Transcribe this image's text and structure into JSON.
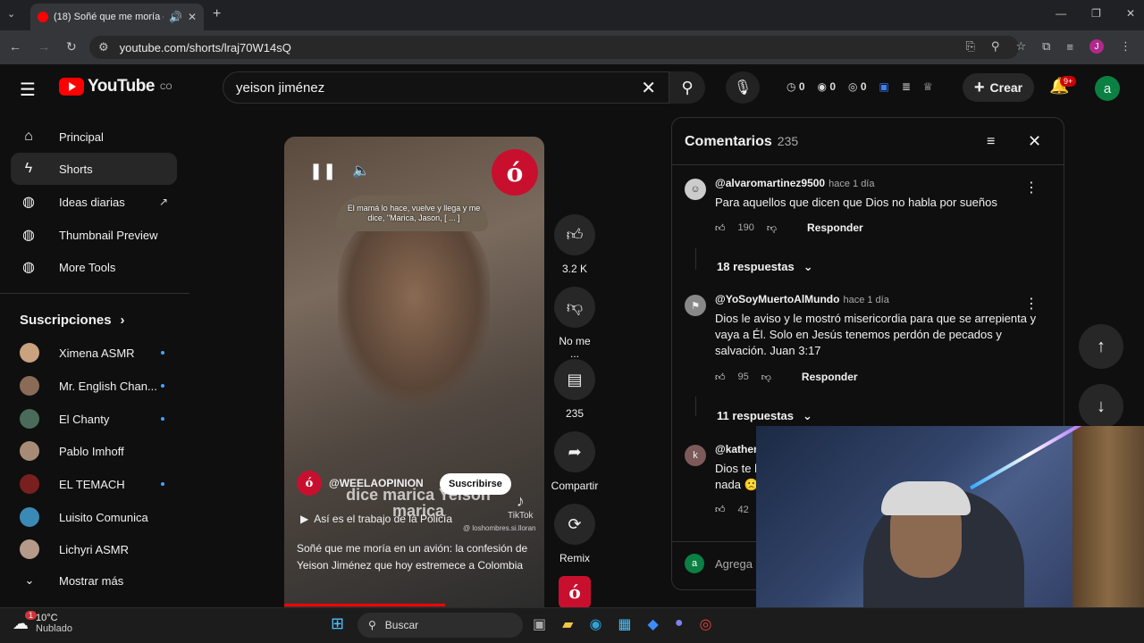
{
  "browser": {
    "tab_title": "(18) Soñé que me moría en",
    "url": "youtube.com/shorts/lraj70W14sQ",
    "profile_initial": "J"
  },
  "header": {
    "logo_text": "YouTube",
    "country": "CO",
    "search_value": "yeison jiménez",
    "ext_counts": [
      "0",
      "0",
      "0"
    ],
    "create_label": "Crear",
    "notif_badge": "9+",
    "account_initial": "a"
  },
  "sidebar": {
    "items": [
      {
        "label": "Principal",
        "icon": "home-icon"
      },
      {
        "label": "Shorts",
        "icon": "shorts-icon"
      },
      {
        "label": "Ideas diarias",
        "icon": "ext-icon"
      },
      {
        "label": "Thumbnail Preview",
        "icon": "ext-icon"
      },
      {
        "label": "More Tools",
        "icon": "ext-icon"
      }
    ],
    "subs_heading": "Suscripciones",
    "subs": [
      {
        "name": "Ximena ASMR",
        "color": "#c9a27e",
        "dot": true
      },
      {
        "name": "Mr. English Chan...",
        "color": "#8a6b57",
        "dot": true
      },
      {
        "name": "El Chanty",
        "color": "#4a6b5a",
        "dot": true
      },
      {
        "name": "Pablo Imhoff",
        "color": "#a88b76",
        "dot": false
      },
      {
        "name": "EL TEMACH",
        "color": "#7a1f1f",
        "dot": true
      },
      {
        "name": "Luisito Comunica",
        "color": "#3a8ab5",
        "dot": false
      },
      {
        "name": "Lichyri ASMR",
        "color": "#b59a8a",
        "dot": false
      }
    ],
    "show_more": "Mostrar más"
  },
  "video": {
    "subtitle": "El mamá lo hace, vuelve y llega y me dice, \"Marica, Jason, [ ... ]",
    "burned_text": "dice marica Yeison marica",
    "tiktok_label": "TikTok",
    "tiktok_handle": "@ loshombres.si.lloran",
    "channel": "@WEELAOPINION",
    "subscribe": "Suscribirse",
    "playlist": "Así es el trabajo de la Policía",
    "title": "Soñé que me moría en un avión: la confesión de Yeison Jiménez que hoy estremece a Colombia",
    "progress": 0.62
  },
  "actions": {
    "likes": "3.2 K",
    "dislike": "No me ...",
    "comments": "235",
    "share": "Compartir",
    "remix": "Remix"
  },
  "comments": {
    "heading": "Comentarios",
    "count": "235",
    "items": [
      {
        "user": "@alvaromartinez9500",
        "time": "hace 1 día",
        "text": "Para aquellos que dicen que Dios no habla por sueños",
        "likes": "190",
        "replies": "18 respuestas"
      },
      {
        "user": "@YoSoyMuertoAlMundo",
        "time": "hace 1 día",
        "text": "Dios le aviso y le mostró misericordia para que se arrepienta y vaya a Él. Solo en Jesús tenemos perdón de pecados y salvación. Juan 3:17",
        "likes": "95",
        "replies": "11 respuestas"
      },
      {
        "user": "@katheri",
        "time": "",
        "text": "Dios te h nada 🙁",
        "likes": "42",
        "replies": ""
      }
    ],
    "reply_label": "Responder",
    "add_placeholder": "Agrega u",
    "me_initial": "a"
  },
  "taskbar": {
    "temp": "10°C",
    "condition": "Nublado",
    "weather_badge": "1",
    "search": "Buscar"
  }
}
